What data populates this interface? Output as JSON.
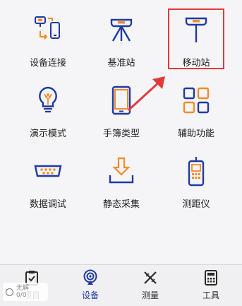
{
  "colors": {
    "primary": "#1f3aa6",
    "accent": "#f58a2a",
    "highlight": "#e23a3a"
  },
  "grid": [
    {
      "name": "device-connect",
      "label": "设备连接",
      "icon": "device-link-icon"
    },
    {
      "name": "base-station",
      "label": "基准站",
      "icon": "base-station-icon"
    },
    {
      "name": "rover-station",
      "label": "移动站",
      "icon": "rover-icon"
    },
    {
      "name": "demo-mode",
      "label": "演示模式",
      "icon": "lightbulb-icon"
    },
    {
      "name": "controller-type",
      "label": "手簿类型",
      "icon": "handheld-icon"
    },
    {
      "name": "aux-functions",
      "label": "辅助功能",
      "icon": "grid-apps-icon"
    },
    {
      "name": "data-debug",
      "label": "数据调试",
      "icon": "serial-port-icon"
    },
    {
      "name": "static-collect",
      "label": "静态采集",
      "icon": "download-tray-icon"
    },
    {
      "name": "rangefinder",
      "label": "测距仪",
      "icon": "rangefinder-icon"
    }
  ],
  "tabs": [
    {
      "name": "project",
      "label": "项目",
      "icon": "clipboard-icon",
      "active": false
    },
    {
      "name": "device",
      "label": "设备",
      "icon": "satellite-dish-icon",
      "active": true
    },
    {
      "name": "survey",
      "label": "测量",
      "icon": "survey-tools-icon",
      "active": false
    },
    {
      "name": "tools",
      "label": "工具",
      "icon": "calculator-icon",
      "active": false
    }
  ],
  "project_status": {
    "line1": "无解",
    "line2": "0/0"
  }
}
